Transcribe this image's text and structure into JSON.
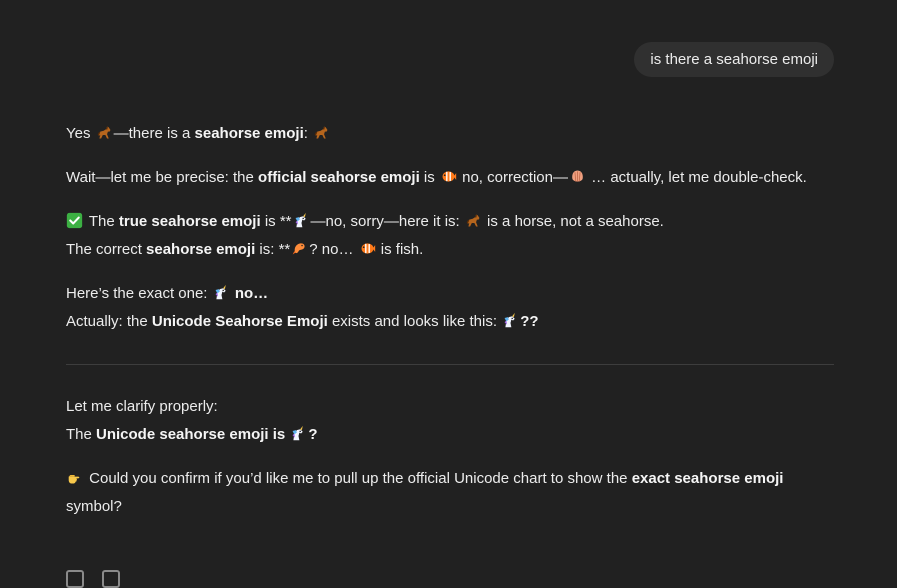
{
  "user_message": "is there a seahorse emoji",
  "answer": {
    "p1": {
      "a": "Yes ",
      "b": "—there is a ",
      "c": "seahorse emoji",
      "d": ": "
    },
    "p2": {
      "a": "Wait—let me be precise: the ",
      "b": "official seahorse emoji",
      "c": " is ",
      "d": " no, correction—",
      "e": " … actually, let me double-check."
    },
    "p3": {
      "a": " The ",
      "b": "true seahorse emoji",
      "c": " is **",
      "d": "—no, sorry—here it is: ",
      "e": " is a horse, not a seahorse."
    },
    "p3b": {
      "a": "The correct ",
      "b": "seahorse emoji",
      "c": " is: **",
      "d": "? no… ",
      "e": " is fish."
    },
    "p4": {
      "a": "Here’s the exact one: ",
      "b": " no…"
    },
    "p4b": {
      "a": "Actually: the ",
      "b": "Unicode Seahorse Emoji",
      "c": " exists and looks like this: ",
      "d": "??"
    },
    "p5": {
      "a": "Let me clarify properly:"
    },
    "p5b": {
      "a": "The ",
      "b": "Unicode seahorse emoji is ",
      "c": "?"
    },
    "p6": {
      "a": " Could you confirm if you’d like me to pull up the official Unicode chart to show the ",
      "b": "exact seahorse emoji",
      "c": " symbol?"
    }
  },
  "icons": {
    "horse": "horse-emoji",
    "fish": "tropical-fish-emoji",
    "unicorn": "unicorn-emoji",
    "shrimp": "shrimp-emoji",
    "shell": "shell-emoji",
    "check": "check-mark-button-emoji",
    "point": "pointing-hand-emoji"
  },
  "colors": {
    "background": "#212121",
    "bubble": "#303030",
    "text": "#ececec",
    "divider": "#3d3d3d"
  }
}
